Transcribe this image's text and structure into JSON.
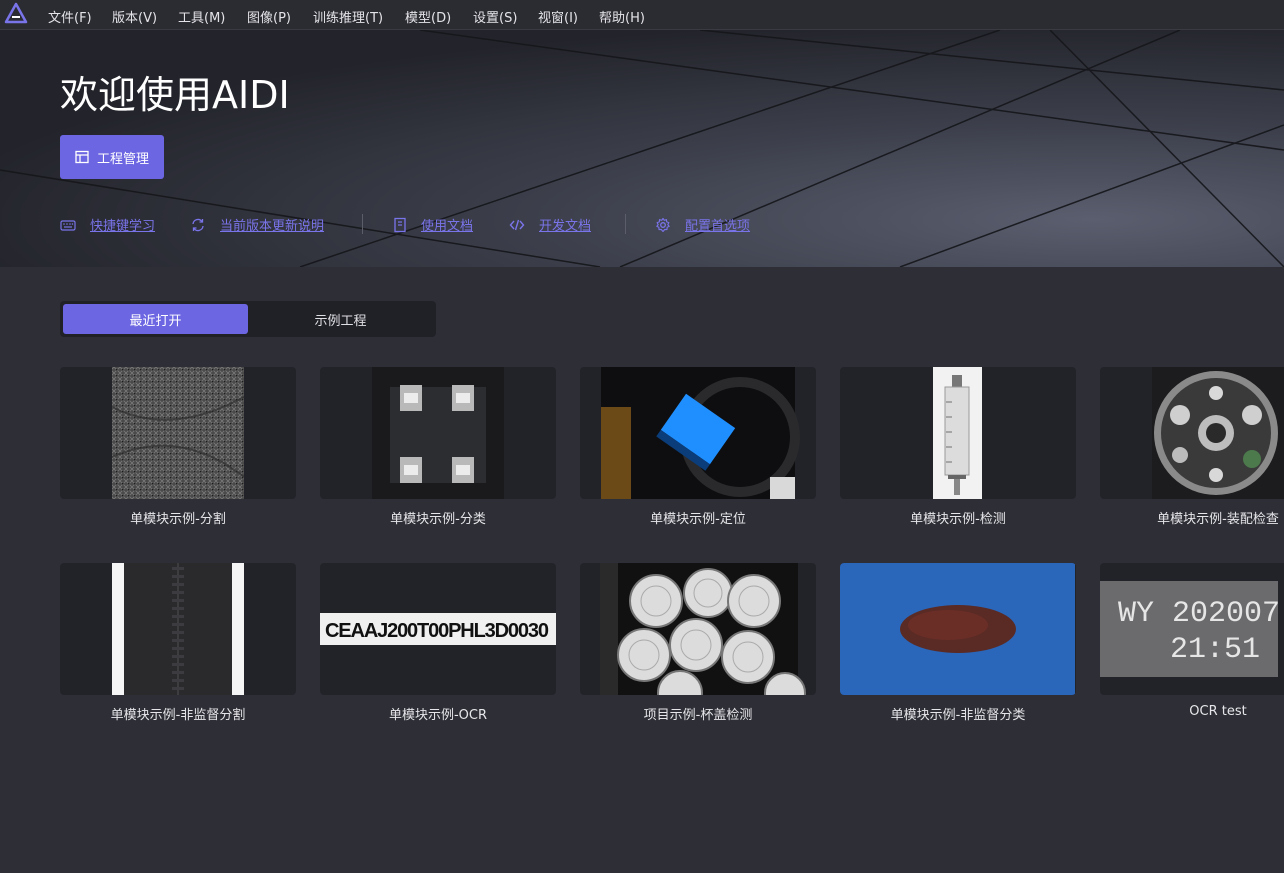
{
  "menu": {
    "items": [
      "文件(F)",
      "版本(V)",
      "工具(M)",
      "图像(P)",
      "训练推理(T)",
      "模型(D)",
      "设置(S)",
      "视窗(I)",
      "帮助(H)"
    ]
  },
  "hero": {
    "title": "欢迎使用AIDI",
    "project_button": "工程管理",
    "links": [
      "快捷键学习",
      "当前版本更新说明",
      "使用文档",
      "开发文档",
      "配置首选项"
    ]
  },
  "tabs": {
    "recent": "最近打开",
    "examples": "示例工程",
    "active": "recent"
  },
  "projects": [
    {
      "label": "单模块示例-分割"
    },
    {
      "label": "单模块示例-分类"
    },
    {
      "label": "单模块示例-定位"
    },
    {
      "label": "单模块示例-检测"
    },
    {
      "label": "单模块示例-装配检查"
    },
    {
      "label": "单模块示例-非监督分割"
    },
    {
      "label": "单模块示例-OCR",
      "thumb_text": "CEAAJ200T00PHL3D0030"
    },
    {
      "label": "项目示例-杯盖检测"
    },
    {
      "label": "单模块示例-非监督分类"
    },
    {
      "label": "OCR test",
      "thumb_text_line1": "WY 202007",
      "thumb_text_line2": "21:51"
    }
  ],
  "colors": {
    "accent": "#6c66e2",
    "link": "#7a74ea",
    "background": "#2e2f36"
  }
}
